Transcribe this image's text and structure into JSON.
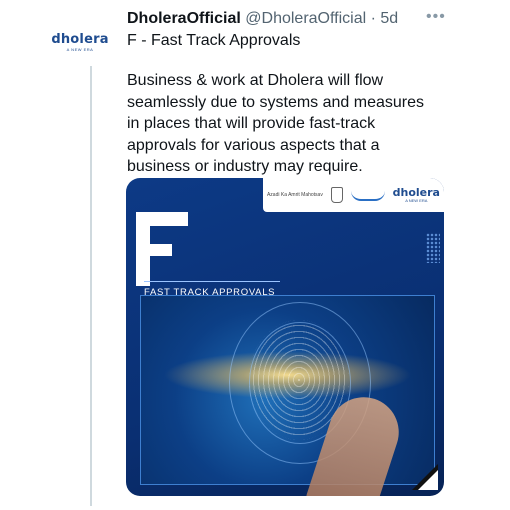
{
  "tweet": {
    "display_name": "DholeraOfficial",
    "handle": "@DholeraOfficial",
    "separator": "·",
    "time": "5d",
    "more_icon": "•••",
    "title": "F - Fast Track Approvals",
    "body": "Business & work at Dholera will flow seamlessly due to systems and measures in places that will provide fast-track approvals for various aspects that a business or industry may require."
  },
  "avatar": {
    "logo_word": "dholera",
    "logo_tag": "A NEW ERA"
  },
  "media": {
    "big_letter": "F",
    "banner_text": "FAST TRACK APPROVALS",
    "strip": {
      "azadi_label": "Azadi Ka Amrit Mahotsav",
      "brand_word": "dholera",
      "brand_tag": "A NEW ERA"
    }
  },
  "colors": {
    "brand_blue": "#1f4c8f",
    "media_bg": "#0d3a86",
    "text": "#0f1419",
    "muted": "#536471"
  }
}
